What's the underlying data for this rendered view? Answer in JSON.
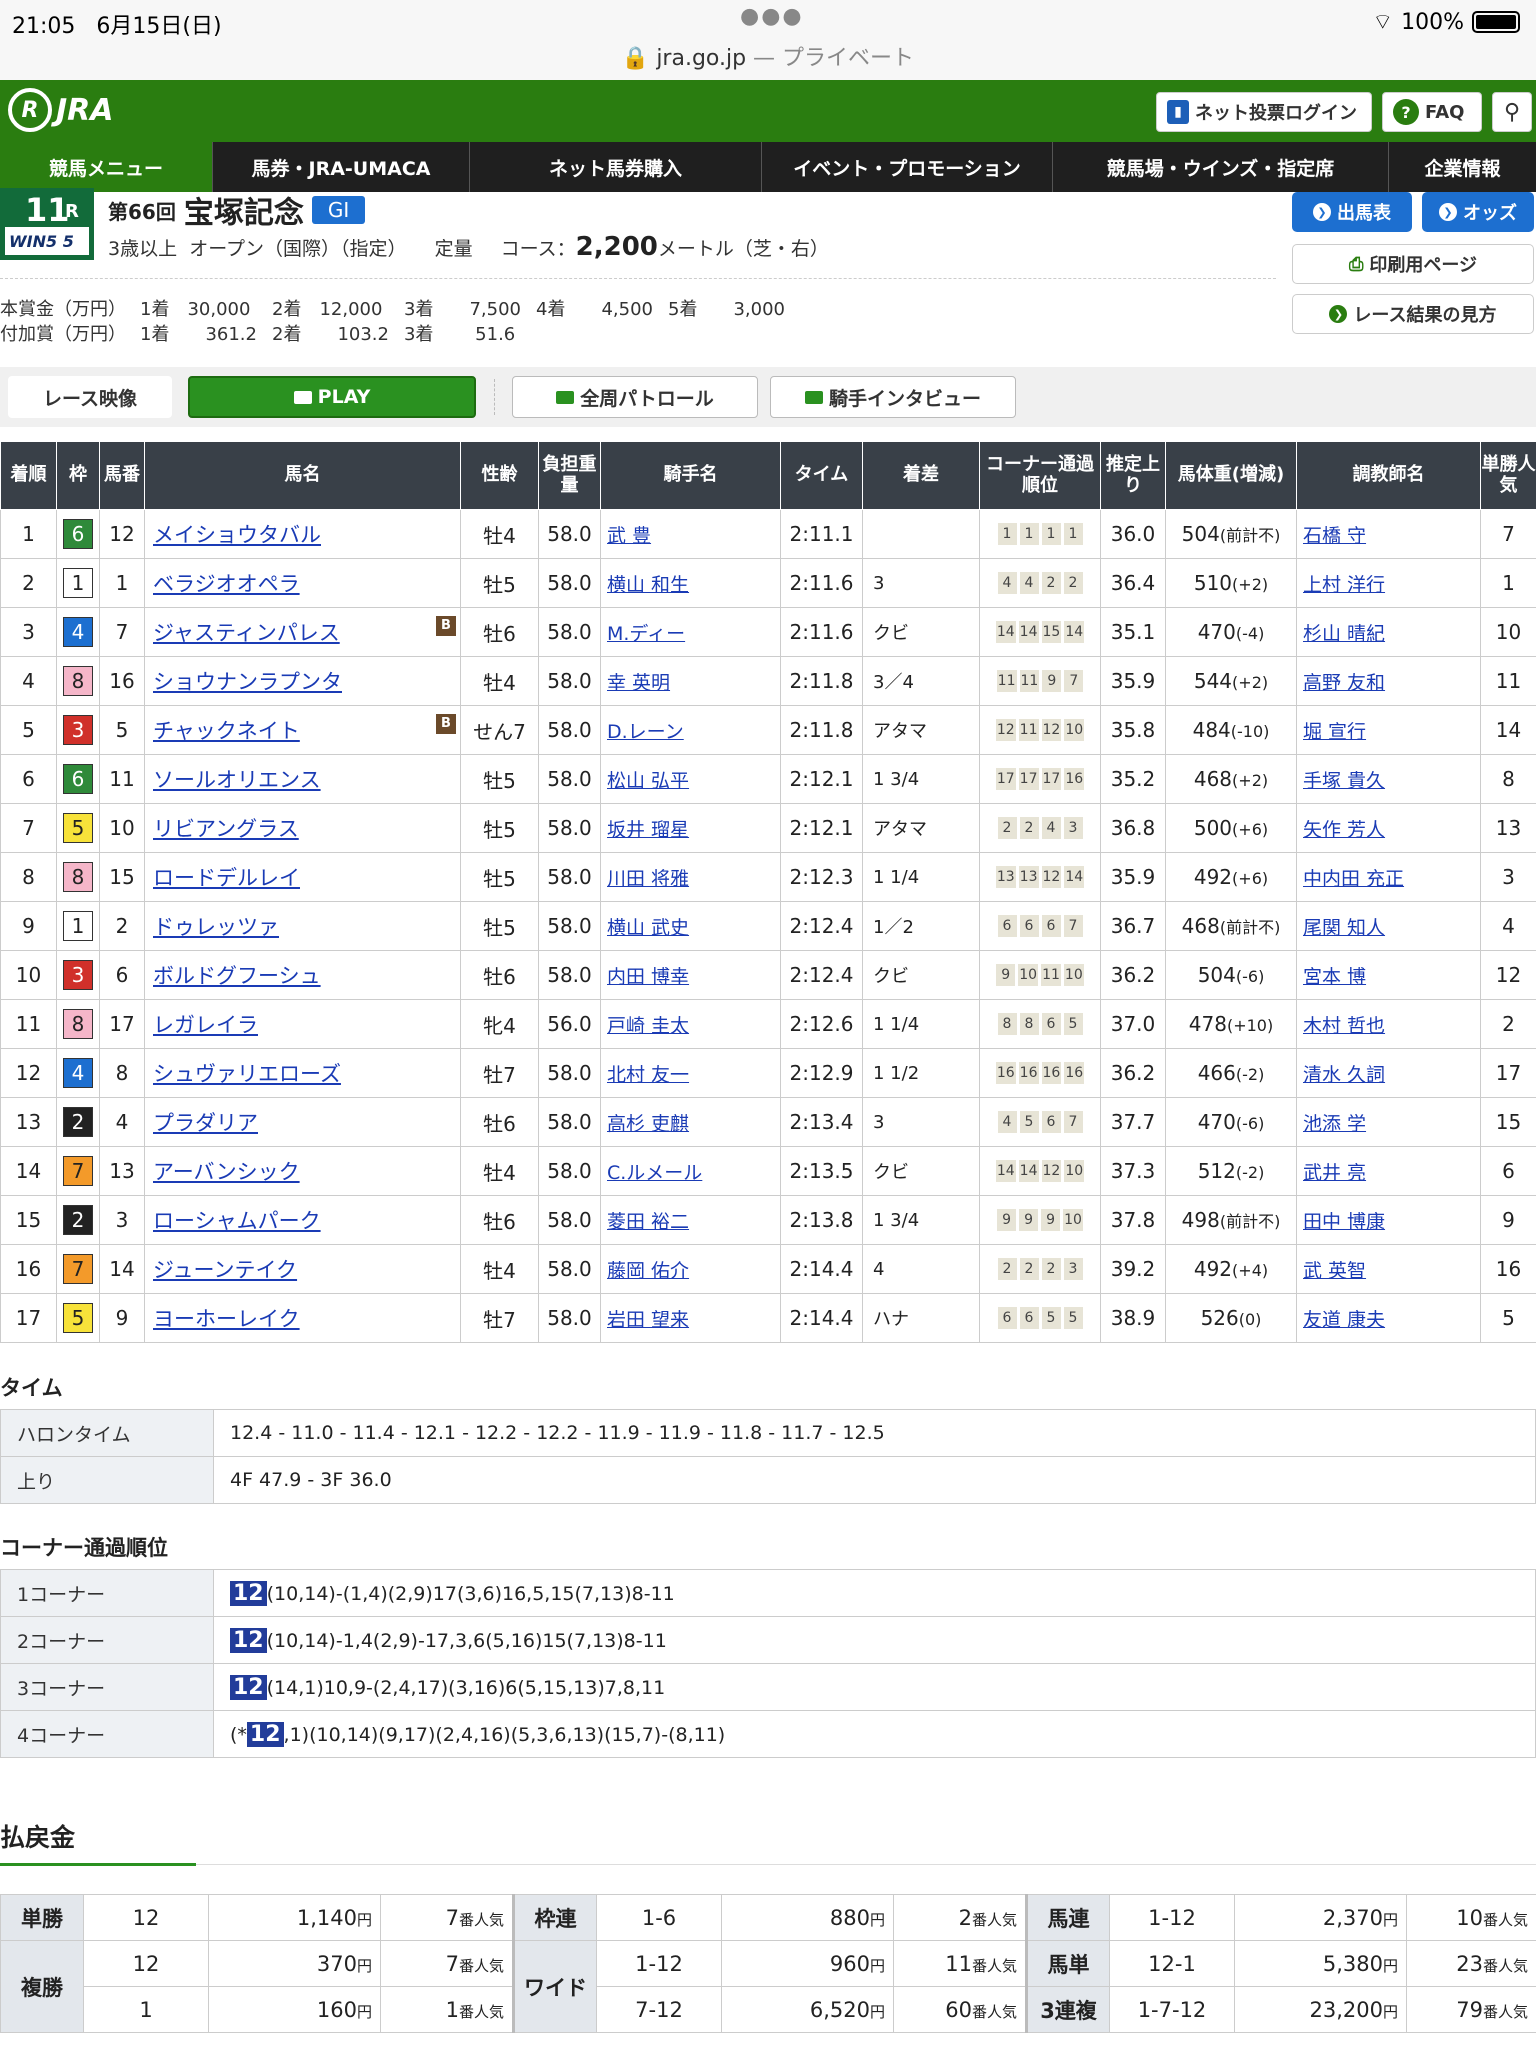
{
  "status": {
    "time": "21:05",
    "date": "6月15日(日)",
    "battery": "100%",
    "url": "jra.go.jp",
    "url_suffix": " — プライベート"
  },
  "header": {
    "logo": "JRA",
    "login_label": "ネット投票ログイン",
    "faq_label": "FAQ"
  },
  "nav": [
    "競馬メニュー",
    "馬券・JRA-UMACA",
    "ネット馬券購入",
    "イベント・プロモーション",
    "競馬場・ウインズ・指定席",
    "企業情報"
  ],
  "race": {
    "number": "11",
    "r": "R",
    "win5": "WIN5 5",
    "kai": "第66回",
    "name": "宝塚記念",
    "grade": "GI",
    "age": "3歳以上",
    "class": "オープン（国際）（指定）",
    "weight_rule": "定量",
    "course_label": "コース：",
    "distance": "2,200",
    "distance_unit": "メートル（芝・右）",
    "prize_label": "本賞金（万円）",
    "prize": [
      "1着　30,000",
      "2着　12,000",
      "3着　　7,500",
      "4着　　4,500",
      "5着　　3,000"
    ],
    "bonus_label": "付加賞（万円）",
    "bonus": [
      "1着　　361.2",
      "2着　　103.2",
      "3着　　 51.6"
    ]
  },
  "race_buttons": {
    "entries": "出馬表",
    "odds": "オッズ",
    "print": "印刷用ページ",
    "howto": "レース結果の見方"
  },
  "video": {
    "label": "レース映像",
    "play": "PLAY",
    "patrol": "全周パトロール",
    "interview": "騎手インタビュー"
  },
  "table_headers": [
    "着順",
    "枠",
    "馬番",
    "馬名",
    "性齢",
    "負担重量",
    "騎手名",
    "タイム",
    "着差",
    "コーナー通過順位",
    "推定上り",
    "馬体重(増減)",
    "調教師名",
    "単勝人気"
  ],
  "waku_colors": {
    "1": [
      "#ffffff",
      "#222222"
    ],
    "2": [
      "#222222",
      "#ffffff"
    ],
    "3": [
      "#d0302a",
      "#ffffff"
    ],
    "4": [
      "#1d6fd0",
      "#ffffff"
    ],
    "5": [
      "#f7e23a",
      "#222222"
    ],
    "6": [
      "#2f8a3a",
      "#ffffff"
    ],
    "7": [
      "#f39a2a",
      "#222222"
    ],
    "8": [
      "#f5b6c9",
      "#222222"
    ]
  },
  "results": [
    {
      "pos": "1",
      "waku": "6",
      "num": "12",
      "horse": "メイショウタバル",
      "blinker": "",
      "sexage": "牡4",
      "weight": "58.0",
      "jockey": "武 豊",
      "time": "2:11.1",
      "margin": "",
      "corners": [
        "1",
        "1",
        "1",
        "1"
      ],
      "last3f": "36.0",
      "bw": "504",
      "bwd": "(前計不)",
      "trainer": "石橋 守",
      "pop": "7"
    },
    {
      "pos": "2",
      "waku": "1",
      "num": "1",
      "horse": "ベラジオオペラ",
      "blinker": "",
      "sexage": "牡5",
      "weight": "58.0",
      "jockey": "横山 和生",
      "time": "2:11.6",
      "margin": "3",
      "corners": [
        "4",
        "4",
        "2",
        "2"
      ],
      "last3f": "36.4",
      "bw": "510",
      "bwd": "(+2)",
      "trainer": "上村 洋行",
      "pop": "1"
    },
    {
      "pos": "3",
      "waku": "4",
      "num": "7",
      "horse": "ジャスティンパレス",
      "blinker": "B",
      "sexage": "牡6",
      "weight": "58.0",
      "jockey": "M.ディー",
      "time": "2:11.6",
      "margin": "クビ",
      "corners": [
        "14",
        "14",
        "15",
        "14"
      ],
      "last3f": "35.1",
      "bw": "470",
      "bwd": "(-4)",
      "trainer": "杉山 晴紀",
      "pop": "10"
    },
    {
      "pos": "4",
      "waku": "8",
      "num": "16",
      "horse": "ショウナンラプンタ",
      "blinker": "",
      "sexage": "牡4",
      "weight": "58.0",
      "jockey": "幸 英明",
      "time": "2:11.8",
      "margin": "3／4",
      "corners": [
        "11",
        "11",
        "9",
        "7"
      ],
      "last3f": "35.9",
      "bw": "544",
      "bwd": "(+2)",
      "trainer": "高野 友和",
      "pop": "11"
    },
    {
      "pos": "5",
      "waku": "3",
      "num": "5",
      "horse": "チャックネイト",
      "blinker": "B",
      "sexage": "せん7",
      "weight": "58.0",
      "jockey": "D.レーン",
      "time": "2:11.8",
      "margin": "アタマ",
      "corners": [
        "12",
        "11",
        "12",
        "10"
      ],
      "last3f": "35.8",
      "bw": "484",
      "bwd": "(-10)",
      "trainer": "堀 宣行",
      "pop": "14"
    },
    {
      "pos": "6",
      "waku": "6",
      "num": "11",
      "horse": "ソールオリエンス",
      "blinker": "",
      "sexage": "牡5",
      "weight": "58.0",
      "jockey": "松山 弘平",
      "time": "2:12.1",
      "margin": "1 3/4",
      "corners": [
        "17",
        "17",
        "17",
        "16"
      ],
      "last3f": "35.2",
      "bw": "468",
      "bwd": "(+2)",
      "trainer": "手塚 貴久",
      "pop": "8"
    },
    {
      "pos": "7",
      "waku": "5",
      "num": "10",
      "horse": "リビアングラス",
      "blinker": "",
      "sexage": "牡5",
      "weight": "58.0",
      "jockey": "坂井 瑠星",
      "time": "2:12.1",
      "margin": "アタマ",
      "corners": [
        "2",
        "2",
        "4",
        "3"
      ],
      "last3f": "36.8",
      "bw": "500",
      "bwd": "(+6)",
      "trainer": "矢作 芳人",
      "pop": "13"
    },
    {
      "pos": "8",
      "waku": "8",
      "num": "15",
      "horse": "ロードデルレイ",
      "blinker": "",
      "sexage": "牡5",
      "weight": "58.0",
      "jockey": "川田 将雅",
      "time": "2:12.3",
      "margin": "1 1/4",
      "corners": [
        "13",
        "13",
        "12",
        "14"
      ],
      "last3f": "35.9",
      "bw": "492",
      "bwd": "(+6)",
      "trainer": "中内田 充正",
      "pop": "3"
    },
    {
      "pos": "9",
      "waku": "1",
      "num": "2",
      "horse": "ドゥレッツァ",
      "blinker": "",
      "sexage": "牡5",
      "weight": "58.0",
      "jockey": "横山 武史",
      "time": "2:12.4",
      "margin": "1／2",
      "corners": [
        "6",
        "6",
        "6",
        "7"
      ],
      "last3f": "36.7",
      "bw": "468",
      "bwd": "(前計不)",
      "trainer": "尾関 知人",
      "pop": "4"
    },
    {
      "pos": "10",
      "waku": "3",
      "num": "6",
      "horse": "ボルドグフーシュ",
      "blinker": "",
      "sexage": "牡6",
      "weight": "58.0",
      "jockey": "内田 博幸",
      "time": "2:12.4",
      "margin": "クビ",
      "corners": [
        "9",
        "10",
        "11",
        "10"
      ],
      "last3f": "36.2",
      "bw": "504",
      "bwd": "(-6)",
      "trainer": "宮本 博",
      "pop": "12"
    },
    {
      "pos": "11",
      "waku": "8",
      "num": "17",
      "horse": "レガレイラ",
      "blinker": "",
      "sexage": "牝4",
      "weight": "56.0",
      "jockey": "戸崎 圭太",
      "time": "2:12.6",
      "margin": "1 1/4",
      "corners": [
        "8",
        "8",
        "6",
        "5"
      ],
      "last3f": "37.0",
      "bw": "478",
      "bwd": "(+10)",
      "trainer": "木村 哲也",
      "pop": "2"
    },
    {
      "pos": "12",
      "waku": "4",
      "num": "8",
      "horse": "シュヴァリエローズ",
      "blinker": "",
      "sexage": "牡7",
      "weight": "58.0",
      "jockey": "北村 友一",
      "time": "2:12.9",
      "margin": "1 1/2",
      "corners": [
        "16",
        "16",
        "16",
        "16"
      ],
      "last3f": "36.2",
      "bw": "466",
      "bwd": "(-2)",
      "trainer": "清水 久詞",
      "pop": "17"
    },
    {
      "pos": "13",
      "waku": "2",
      "num": "4",
      "horse": "プラダリア",
      "blinker": "",
      "sexage": "牡6",
      "weight": "58.0",
      "jockey": "高杉 吏麒",
      "time": "2:13.4",
      "margin": "3",
      "corners": [
        "4",
        "5",
        "6",
        "7"
      ],
      "last3f": "37.7",
      "bw": "470",
      "bwd": "(-6)",
      "trainer": "池添 学",
      "pop": "15"
    },
    {
      "pos": "14",
      "waku": "7",
      "num": "13",
      "horse": "アーバンシック",
      "blinker": "",
      "sexage": "牡4",
      "weight": "58.0",
      "jockey": "C.ルメール",
      "time": "2:13.5",
      "margin": "クビ",
      "corners": [
        "14",
        "14",
        "12",
        "10"
      ],
      "last3f": "37.3",
      "bw": "512",
      "bwd": "(-2)",
      "trainer": "武井 亮",
      "pop": "6"
    },
    {
      "pos": "15",
      "waku": "2",
      "num": "3",
      "horse": "ローシャムパーク",
      "blinker": "",
      "sexage": "牡6",
      "weight": "58.0",
      "jockey": "菱田 裕二",
      "time": "2:13.8",
      "margin": "1 3/4",
      "corners": [
        "9",
        "9",
        "9",
        "10"
      ],
      "last3f": "37.8",
      "bw": "498",
      "bwd": "(前計不)",
      "trainer": "田中 博康",
      "pop": "9"
    },
    {
      "pos": "16",
      "waku": "7",
      "num": "14",
      "horse": "ジューンテイク",
      "blinker": "",
      "sexage": "牡4",
      "weight": "58.0",
      "jockey": "藤岡 佑介",
      "time": "2:14.4",
      "margin": "4",
      "corners": [
        "2",
        "2",
        "2",
        "3"
      ],
      "last3f": "39.2",
      "bw": "492",
      "bwd": "(+4)",
      "trainer": "武 英智",
      "pop": "16"
    },
    {
      "pos": "17",
      "waku": "5",
      "num": "9",
      "horse": "ヨーホーレイク",
      "blinker": "",
      "sexage": "牡7",
      "weight": "58.0",
      "jockey": "岩田 望来",
      "time": "2:14.4",
      "margin": "ハナ",
      "corners": [
        "6",
        "6",
        "5",
        "5"
      ],
      "last3f": "38.9",
      "bw": "526",
      "bwd": "(0)",
      "trainer": "友道 康夫",
      "pop": "5"
    }
  ],
  "time_section": {
    "title": "タイム",
    "rows": [
      {
        "k": "ハロンタイム",
        "v": "12.4 - 11.0 - 11.4 - 12.1 - 12.2 - 12.2 - 11.9 - 11.9 - 11.8 - 11.7 - 12.5"
      },
      {
        "k": "上り",
        "v": "4F 47.9 - 3F 36.0"
      }
    ]
  },
  "corner_section": {
    "title": "コーナー通過順位",
    "rows": [
      {
        "k": "1コーナー",
        "pre": "",
        "lead": "12",
        "post": "(10,14)-(1,4)(2,9)17(3,6)16,5,15(7,13)8-11"
      },
      {
        "k": "2コーナー",
        "pre": "",
        "lead": "12",
        "post": "(10,14)-1,4(2,9)-17,3,6(5,16)15(7,13)8-11"
      },
      {
        "k": "3コーナー",
        "pre": "",
        "lead": "12",
        "post": "(14,1)10,9-(2,4,17)(3,16)6(5,15,13)7,8,11"
      },
      {
        "k": "4コーナー",
        "pre": "(*",
        "lead": "12",
        "post": ",1)(10,14)(9,17)(2,4,16)(5,3,6,13)(15,7)-(8,11)"
      }
    ]
  },
  "payout": {
    "title": "払戻金",
    "yen": "円",
    "pop_suffix": "番人気",
    "rows": [
      [
        {
          "t": "単勝",
          "n": "12",
          "p": "1,140",
          "o": "7"
        },
        {
          "t": "枠連",
          "n": "1-6",
          "p": "880",
          "o": "2"
        },
        {
          "t": "馬連",
          "n": "1-12",
          "p": "2,370",
          "o": "10"
        }
      ],
      [
        {
          "t": "",
          "n": "12",
          "p": "370",
          "o": "7"
        },
        {
          "t": "",
          "n": "1-12",
          "p": "960",
          "o": "11"
        },
        {
          "t": "馬単",
          "n": "12-1",
          "p": "5,380",
          "o": "23"
        }
      ],
      [
        {
          "t": "",
          "n": "1",
          "p": "160",
          "o": "1"
        },
        {
          "t": "",
          "n": "7-12",
          "p": "6,520",
          "o": "60"
        },
        {
          "t": "3連複",
          "n": "1-7-12",
          "p": "23,200",
          "o": "79"
        }
      ]
    ],
    "fukusho_label": "複勝",
    "wide_label": "ワイド"
  }
}
